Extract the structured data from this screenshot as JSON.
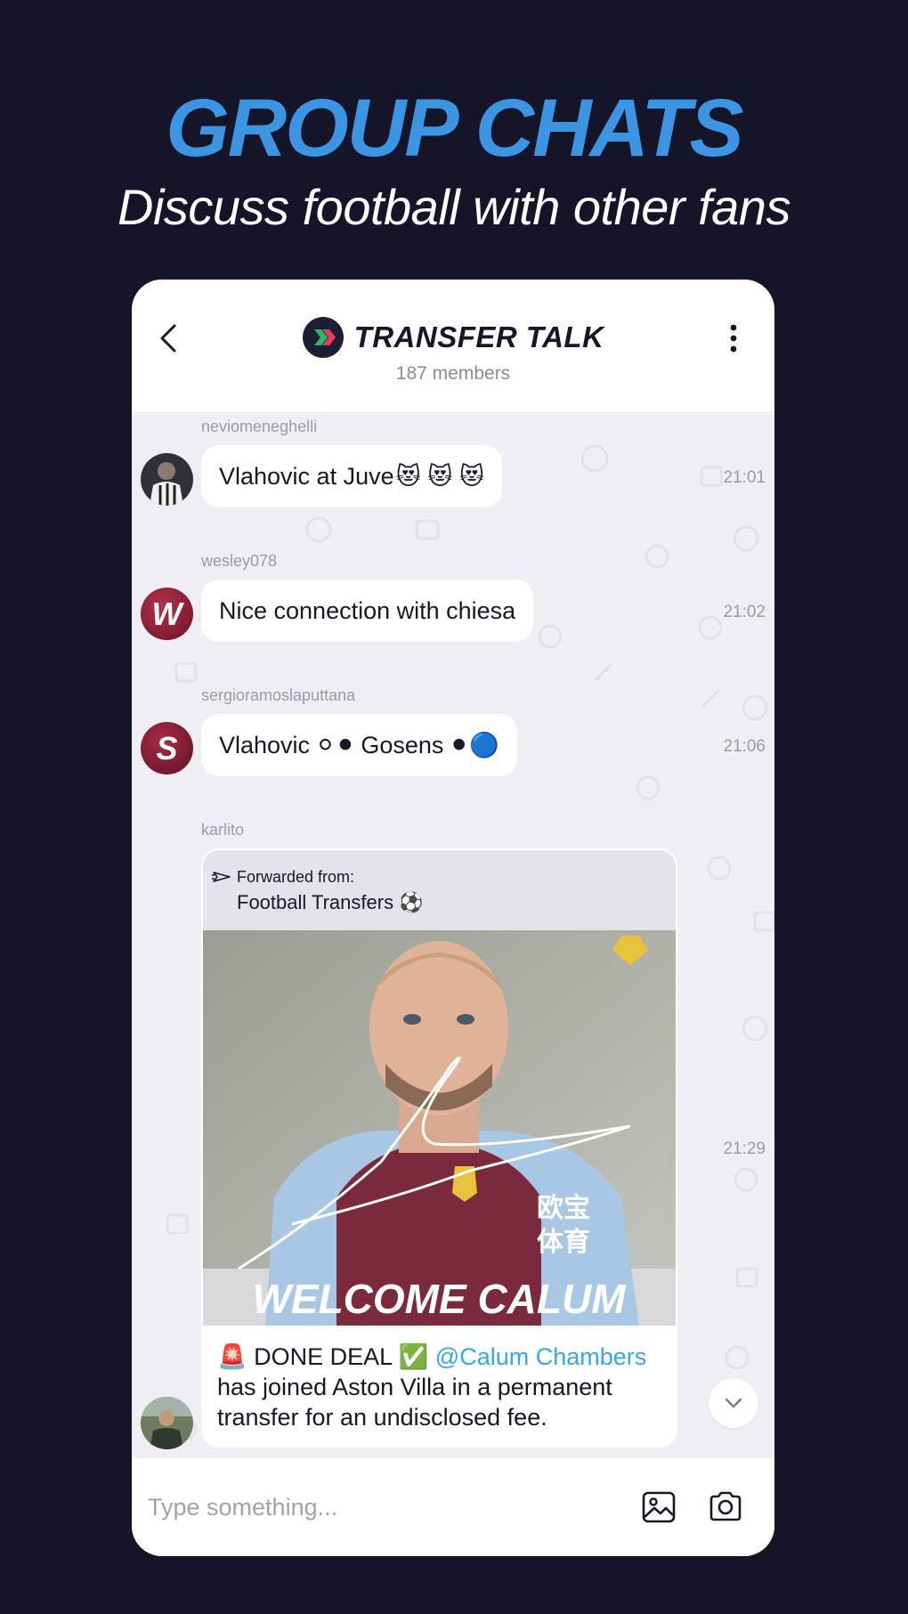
{
  "promo": {
    "headline": "GROUP CHATS",
    "subheadline": "Discuss football with other fans"
  },
  "header": {
    "title": "TRANSFER TALK",
    "members": "187 members"
  },
  "messages": [
    {
      "username": "neviomeneghelli",
      "text": "Vlahovic at Juve",
      "emoji": "😻 😻 😻",
      "time": "21:01",
      "avatar_type": "photo"
    },
    {
      "username": "wesley078",
      "text": "Nice connection with chiesa",
      "time": "21:02",
      "avatar_letter": "W"
    },
    {
      "username": "sergioramoslaputtana",
      "text_part1": "Vlahovic",
      "emoji_part1": "⚪⚫",
      "text_part2": "Gosens",
      "emoji_part2": "⚫🔵",
      "time": "21:06",
      "avatar_letter": "S"
    },
    {
      "username": "karlito",
      "time": "21:29",
      "forwarded_label": "Forwarded from:",
      "forwarded_source": "Football Transfers ⚽",
      "image_caption_text": "WELCOME CALUM",
      "caption_prefix": "🚨 DONE DEAL ✅",
      "caption_mention": "@Calum Chambers",
      "caption_rest": "has joined Aston Villa in a permanent transfer for an undisclosed fee."
    }
  ],
  "composer": {
    "placeholder": "Type something..."
  },
  "colors": {
    "background": "#141529",
    "accent": "#3b95e3",
    "mention": "#3aa4e9",
    "chat_bg": "#efeef4"
  },
  "icons": [
    "back-icon",
    "more-vertical-icon",
    "forward-icon",
    "chevron-down-icon",
    "image-icon",
    "camera-icon"
  ]
}
